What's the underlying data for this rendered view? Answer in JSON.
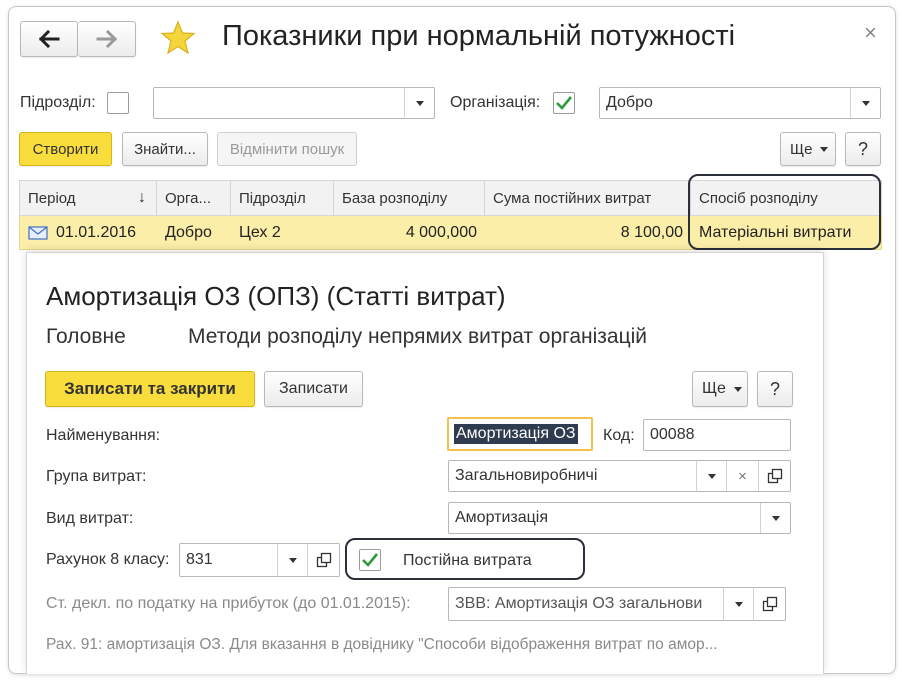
{
  "window": {
    "title": "Показники при нормальній потужності",
    "back_icon": "arrow-left-icon",
    "forward_icon": "arrow-right-icon",
    "favorite_icon": "star-icon",
    "close_glyph": "×"
  },
  "filters": {
    "subdivision_label": "Підрозділ:",
    "subdivision_value": "",
    "organization_label": "Організація:",
    "organization_checked": true,
    "organization_value": "Добро"
  },
  "toolbar": {
    "create_label": "Створити",
    "find_label": "Знайти...",
    "cancel_search_label": "Відмінити пошук",
    "more_label": "Ще",
    "help_label": "?"
  },
  "table": {
    "columns": [
      "Період",
      "Орга...",
      "Підрозділ",
      "База розподілу",
      "Сума постійних витрат",
      "Спосіб розподілу"
    ],
    "sort_glyph": "↓",
    "rows": [
      {
        "icon": "envelope-icon",
        "period": "01.01.2016",
        "organization": "Добро",
        "subdivision": "Цех 2",
        "base": "4 000,000",
        "fixed_costs": "8 100,00",
        "method": "Матеріальні витрати"
      }
    ]
  },
  "subform": {
    "title": "Амортизація ОЗ (ОПЗ) (Статті витрат)",
    "tabs": [
      "Головне",
      "Методи розподілу непрямих витрат організацій"
    ],
    "save_close_label": "Записати та закрити",
    "save_label": "Записати",
    "more_label": "Ще",
    "help_label": "?",
    "name_label": "Найменування:",
    "name_value": "Амортизація ОЗ",
    "code_label": "Код:",
    "code_value": "00088",
    "group_label": "Група витрат:",
    "group_value": "Загальновиробничі",
    "kind_label": "Вид витрат:",
    "kind_value": "Амортизація",
    "account_label": "Рахунок 8 класу:",
    "account_value": "831",
    "fixed_cost_label": "Постійна витрата",
    "fixed_cost_checked": true,
    "tax_label": "Ст. декл. по податку на прибуток (до 01.01.2015):",
    "tax_value": "ЗВВ: Амортизація ОЗ загальнови",
    "note": "Рах. 91: амортизація ОЗ. Для вказання в довіднику \"Способи відображення витрат по амор..."
  },
  "colors": {
    "accent_yellow": "#f9dd3c",
    "selected_row": "#fbeea8",
    "check_green": "#2e9b3a",
    "highlight_outline": "#2b2f3a"
  }
}
